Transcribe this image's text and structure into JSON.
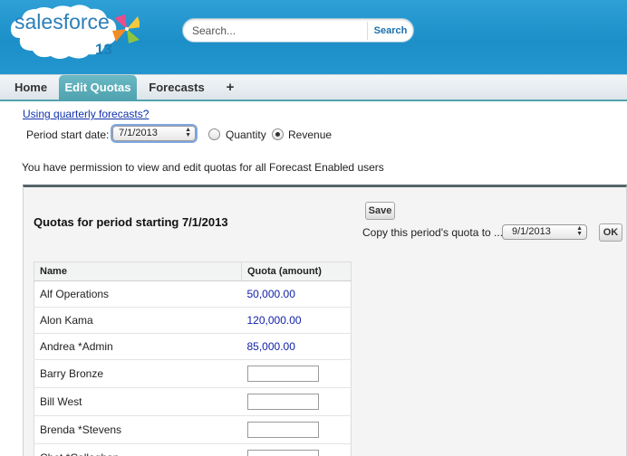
{
  "brand": {
    "name": "salesforce",
    "release": "13",
    "colors": {
      "header": "#1c8fc9",
      "tab_active": "#4ea1ae",
      "link": "#1133aa"
    }
  },
  "search": {
    "placeholder": "Search...",
    "button_label": "Search"
  },
  "tabs": [
    {
      "label": "Home",
      "active": false
    },
    {
      "label": "Edit Quotas",
      "active": true
    },
    {
      "label": "Forecasts",
      "active": false
    },
    {
      "label": "+",
      "active": false
    }
  ],
  "options": {
    "link_text": "Using quarterly forecasts?",
    "period_label": "Period start date:",
    "period_value": "7/1/2013",
    "radio_quantity": "Quantity",
    "radio_revenue": "Revenue",
    "selected_radio": "Revenue"
  },
  "permission_text": "You have permission to view and edit quotas for all Forecast Enabled users",
  "panel": {
    "title": "Quotas for period starting 7/1/2013",
    "save_label": "Save",
    "copy_label": "Copy this period's quota to ...",
    "copy_value": "9/1/2013",
    "ok_label": "OK"
  },
  "table": {
    "headers": [
      "Name",
      "Quota (amount)"
    ],
    "rows": [
      {
        "name": "Alf Operations",
        "quota": "50,000.00"
      },
      {
        "name": "Alon Kama",
        "quota": "120,000.00"
      },
      {
        "name": "Andrea *Admin",
        "quota": "85,000.00"
      },
      {
        "name": "Barry Bronze",
        "quota": ""
      },
      {
        "name": "Bill West",
        "quota": ""
      },
      {
        "name": "Brenda *Stevens",
        "quota": ""
      },
      {
        "name": "Chet *Callaghan",
        "quota": ""
      }
    ]
  }
}
